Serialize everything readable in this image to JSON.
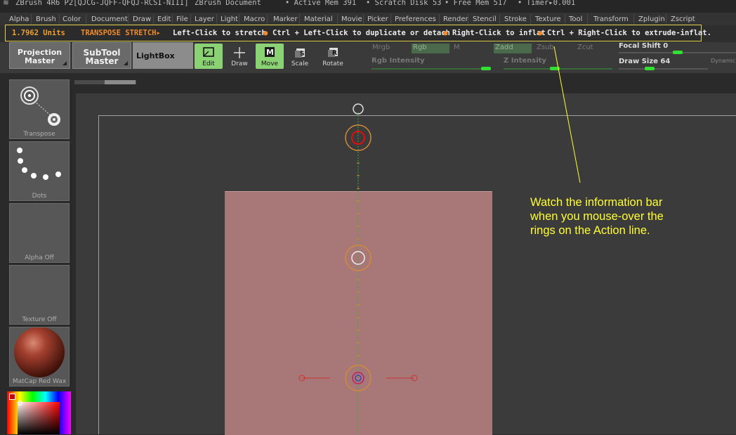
{
  "titlebar": {
    "app": "ZBrush 4R6 P2[QJCG-JQFF-QFQJ-RCSI-NIII]",
    "doc": "ZBrush Document",
    "active_mem": "• Active Mem 391",
    "scratch": "• Scratch Disk 53",
    "free_mem": "• Free Mem 517",
    "timer": "• Timer▸0.001"
  },
  "menu": [
    "Alpha",
    "Brush",
    "Color",
    "Document",
    "Draw",
    "Edit",
    "File",
    "Layer",
    "Light",
    "Macro",
    "Marker",
    "Material",
    "Movie",
    "Picker",
    "Preferences",
    "Render",
    "Stencil",
    "Stroke",
    "Texture",
    "Tool",
    "Transform",
    "Zplugin",
    "Zscript"
  ],
  "infobar": {
    "units": "1.7962 Units",
    "mode": "TRANSPOSE STRETCH▸",
    "part1": "Left-Click to stretch",
    "part2": "Ctrl + Left-Click to duplicate or detach",
    "part3": "Right-Click to inflat",
    "part4": "Ctrl + Right-Click to extrude-inflat.",
    "bullet": "●"
  },
  "toolbar": {
    "projection_master_1": "Projection",
    "projection_master_2": "Master",
    "subtool_master_1": "SubTool",
    "subtool_master_2": "Master",
    "lightbox": "LightBox",
    "edit": "Edit",
    "draw": "Draw",
    "move": "Move",
    "scale": "Scale",
    "rotate": "Rotate",
    "mrgb": "Mrgb",
    "rgb": "Rgb",
    "m": "M",
    "zadd": "Zadd",
    "zsub": "Zsub",
    "zcut": "Zcut",
    "rgb_intensity": "Rgb Intensity",
    "z_intensity": "Z Intensity",
    "focal_shift": "Focal Shift 0",
    "draw_size": "Draw Size 64",
    "dynamic": "Dynamic",
    "rgb_intensity_level": 1.0,
    "z_intensity_level": 0.25,
    "focal_shift_level": 0.5,
    "draw_size_level": 0.35
  },
  "tray": {
    "transpose": "Transpose",
    "dots": "Dots",
    "alpha": "Alpha  Off",
    "texture": "Texture  Off",
    "matcap": "MatCap  Red  Wax"
  },
  "callout": {
    "line1": "Watch the information bar",
    "line2": "when you mouse-over the",
    "line3": "rings on the Action line."
  },
  "colors": {
    "accent_orange": "#f08a2a",
    "active_green": "#8ad273",
    "callout_yellow": "#ffff33",
    "mesh": "#a87878"
  }
}
